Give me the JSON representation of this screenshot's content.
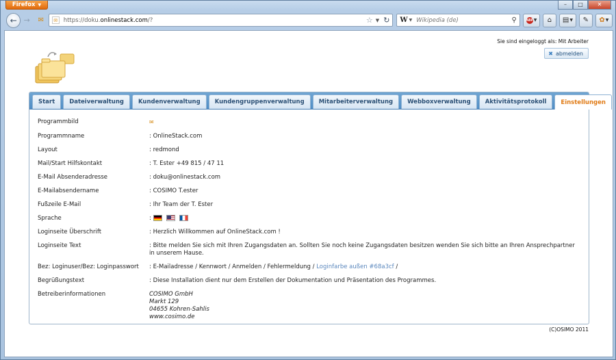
{
  "browser": {
    "app_button": "Firefox",
    "url_prefix": "https://doku.",
    "url_domain": "onlinestack.com",
    "url_suffix": "/?",
    "search_engine_glyph": "W",
    "search_placeholder": "Wikipedia (de)",
    "window_controls": [
      "–",
      "□",
      "✕"
    ]
  },
  "header": {
    "login_status": "Sie sind eingeloggt als: Mit Arbeiter",
    "logout_label": "abmelden"
  },
  "tabs": [
    {
      "label": "Start"
    },
    {
      "label": "Dateiverwaltung"
    },
    {
      "label": "Kundenverwaltung"
    },
    {
      "label": "Kundengruppenverwaltung"
    },
    {
      "label": "Mitarbeiterverwaltung"
    },
    {
      "label": "Webboxverwaltung"
    },
    {
      "label": "Aktivitätsprotokoll"
    },
    {
      "label": "Einstellungen",
      "active": true
    }
  ],
  "settings": {
    "programmbild": {
      "label": "Programmbild"
    },
    "programmname": {
      "label": "Programmname",
      "value": ": OnlineStack.com"
    },
    "layout": {
      "label": "Layout",
      "value": ": redmond"
    },
    "hilfskontakt": {
      "label": "Mail/Start Hilfskontakt",
      "value": ": T. Ester +49 815 / 47 11"
    },
    "absenderadresse": {
      "label": "E-Mail Absenderadresse",
      "value": ": doku@onlinestack.com"
    },
    "absendername": {
      "label": "E-Mailabsendername",
      "value": ": COSIMO T.ester"
    },
    "fusszeile": {
      "label": "Fußzeile E-Mail",
      "value": ": Ihr Team der T. Ester"
    },
    "sprache": {
      "label": "Sprache",
      "value": ":"
    },
    "ueberschrift": {
      "label": "Loginseite Überschrift",
      "value": ": Herzlich Willkommen auf OnlineStack.com !"
    },
    "logintext": {
      "label": "Loginseite Text",
      "value": ": Bitte melden Sie sich mit Ihren Zugangsdaten an. Sollten Sie noch keine Zugangsdaten besitzen wenden Sie sich bitte an Ihren Ansprechpartner in unserem Hause."
    },
    "loginuser": {
      "label": "Bez: Loginuser/Bez: Loginpasswort",
      "value": ": E-Mailadresse  / Kennwort / Anmelden  / Fehlermeldung  / ",
      "link": "Loginfarbe außen #68a3cf",
      "tail": " /"
    },
    "begruessung": {
      "label": "Begrüßungstext",
      "value": ": Diese Installation dient nur dem Erstellen der Dokumentation und Präsentation des Programmes."
    },
    "betreiber": {
      "label": "Betreiberinformationen",
      "lines": [
        "COSIMO GmbH",
        "Markt 129",
        "04655 Kohren-Sahlis",
        "www.cosimo.de"
      ]
    }
  },
  "footer": {
    "copyright": "(C)OSIMO 2011"
  }
}
